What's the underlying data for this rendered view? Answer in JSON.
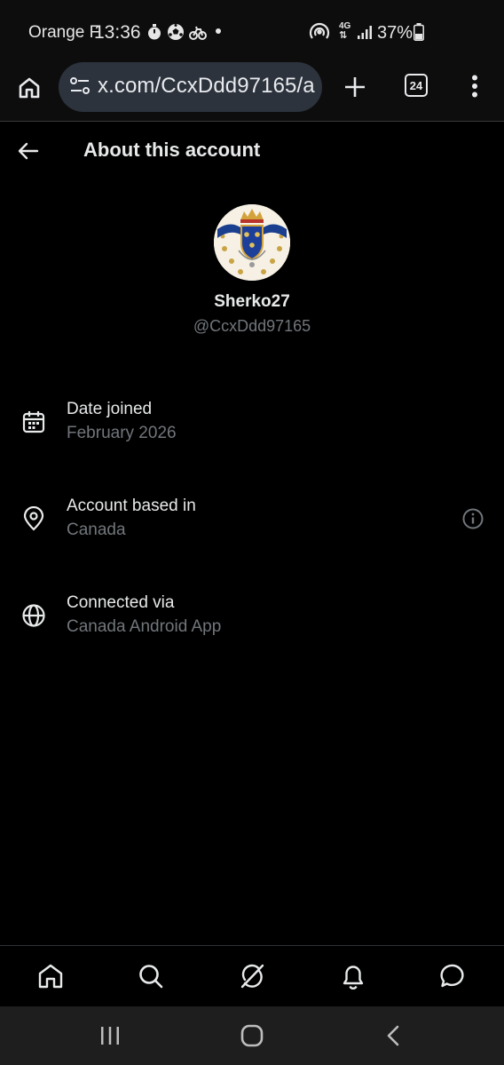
{
  "status_bar": {
    "carrier": "Orange F",
    "time": "13:36",
    "network": "4G",
    "battery": "37%"
  },
  "browser": {
    "url": "x.com/CcxDdd97165/a",
    "tab_count": "24",
    "icons": [
      "home-icon",
      "site-settings-icon",
      "new-tab-icon",
      "tabs-icon",
      "menu-icon"
    ]
  },
  "header": {
    "title": "About this account"
  },
  "profile": {
    "display_name": "Sherko27",
    "handle": "@CcxDdd97165"
  },
  "info_rows": [
    {
      "label": "Date joined",
      "value": "February 2026",
      "icon": "calendar-icon"
    },
    {
      "label": "Account based in",
      "value": "Canada",
      "icon": "location-pin-icon"
    },
    {
      "label": "Connected via",
      "value": "Canada Android App",
      "icon": "globe-icon"
    }
  ],
  "bottom_nav": [
    "home-icon",
    "search-icon",
    "grok-icon",
    "notifications-icon",
    "messages-icon"
  ],
  "colors": {
    "background": "#000000",
    "primary_text": "#e7e9ea",
    "secondary_text": "#71767b",
    "url_pill": "#2c333d"
  }
}
